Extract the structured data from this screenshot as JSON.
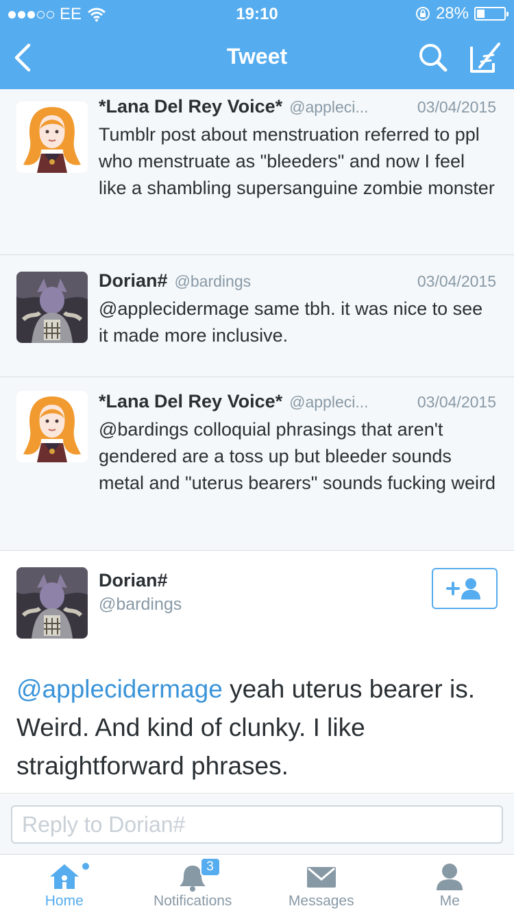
{
  "status": {
    "carrier": "EE",
    "time": "19:10",
    "battery": "28%",
    "battery_level": 0.28
  },
  "nav": {
    "title": "Tweet"
  },
  "conversation": [
    {
      "name": "*Lana Del Rey Voice*",
      "handle": "@appleci...",
      "date": "03/04/2015",
      "text": "Tumblr post about menstruation referred to ppl who menstruate as \"bleeders\" and now I feel like a shambling supersanguine zombie monster"
    },
    {
      "name": "Dorian#",
      "handle": "@bardings",
      "date": "03/04/2015",
      "text": "@applecidermage same tbh. it was nice to see it made more inclusive."
    },
    {
      "name": "*Lana Del Rey Voice*",
      "handle": "@appleci...",
      "date": "03/04/2015",
      "text": "@bardings colloquial phrasings that aren't gendered are a toss up but bleeder sounds metal and \"uterus bearers\" sounds fucking weird"
    }
  ],
  "main_tweet": {
    "name": "Dorian#",
    "handle": "@bardings",
    "mention": "@applecidermage",
    "text": " yeah uterus bearer is. Weird. And kind of clunky. I like straightforward phrases."
  },
  "reply": {
    "placeholder": "Reply to Dorian#"
  },
  "tabs": {
    "home": "Home",
    "notifications": "Notifications",
    "notifications_badge": "3",
    "messages": "Messages",
    "me": "Me"
  },
  "colors": {
    "brand": "#55acee",
    "link": "#3b94d9",
    "muted": "#8899a6"
  }
}
